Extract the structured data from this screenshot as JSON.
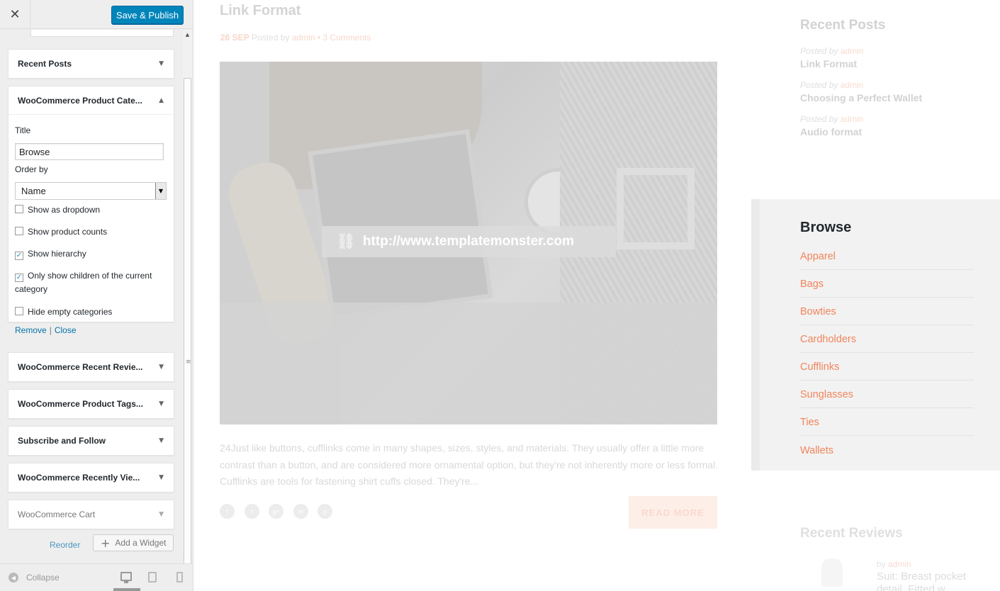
{
  "customizer": {
    "close_icon": "✕",
    "save_label": "Save & Publish",
    "widgets": [
      {
        "title": "Recent Posts",
        "expanded": false
      },
      {
        "title": "WooCommerce Product Cate...",
        "expanded": true
      },
      {
        "title": "WooCommerce Recent Revie...",
        "expanded": false
      },
      {
        "title": "WooCommerce Product Tags...",
        "expanded": false
      },
      {
        "title": "Subscribe and Follow",
        "expanded": false
      },
      {
        "title": "WooCommerce Recently Vie...",
        "expanded": false
      },
      {
        "title": "WooCommerce Cart",
        "expanded": false
      }
    ],
    "category_widget": {
      "title_label": "Title",
      "title_value": "Browse",
      "order_label": "Order by",
      "order_value": "Name",
      "checkboxes": [
        {
          "label": "Show as dropdown",
          "checked": false
        },
        {
          "label": "Show product counts",
          "checked": false
        },
        {
          "label": "Show hierarchy",
          "checked": true
        },
        {
          "label": "Only show children of the current category",
          "checked": true
        },
        {
          "label": "Hide empty categories",
          "checked": false
        }
      ],
      "remove_label": "Remove",
      "separator": "|",
      "close_label": "Close"
    },
    "reorder_label": "Reorder",
    "add_widget_label": "Add a Widget",
    "collapse_label": "Collapse",
    "active_device": "desktop"
  },
  "preview": {
    "post": {
      "title": "Link Format",
      "date": "26 SEP",
      "posted_by": "Posted by",
      "author": "admin",
      "dot": "•",
      "comments": "3 Comments",
      "link_url": "http://www.templatemonster.com",
      "excerpt": "24Just like buttons, cufflinks come in many shapes, sizes, styles, and materials. They usually offer a little more contrast than a button, and are considered more ornamental option, but they're not inherently more or less for­mal. Cufflinks are tools for fastening shirt cuffs closed. They're...",
      "social_icons": [
        "f",
        "t",
        "g+",
        "in",
        "p"
      ],
      "read_more": "READ MORE"
    },
    "recent_posts": {
      "heading": "Recent Posts",
      "items": [
        {
          "by": "Posted by",
          "author": "admin",
          "title": "Link Format"
        },
        {
          "by": "Posted by",
          "author": "admin",
          "title": "Choosing a Perfect Wallet"
        },
        {
          "by": "Posted by",
          "author": "admin",
          "title": "Audio format"
        }
      ]
    },
    "browse": {
      "heading": "Browse",
      "categories": [
        "Apparel",
        "Bags",
        "Bowties",
        "Cardholders",
        "Cufflinks",
        "Sunglasses",
        "Ties",
        "Wallets"
      ]
    },
    "recent_reviews": {
      "heading": "Recent Reviews",
      "by": "by",
      "author": "admin",
      "title": "Suit: Breast pocket detail, Fitted w..."
    }
  },
  "colors": {
    "accent": "#f0855b",
    "wp_blue": "#0085ba",
    "link_blue": "#0073aa"
  }
}
